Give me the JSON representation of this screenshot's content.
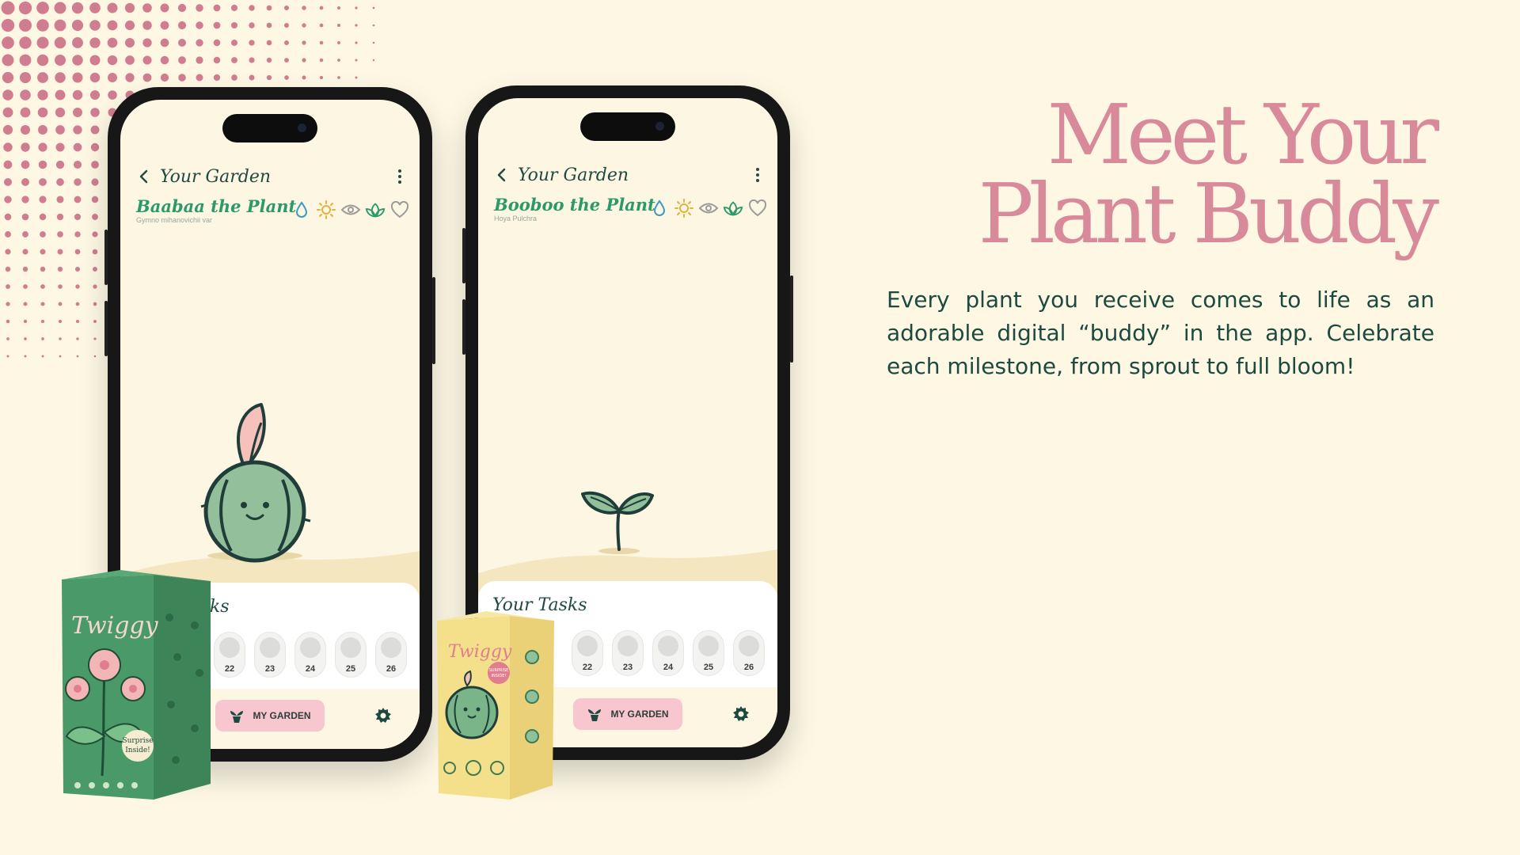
{
  "headline": {
    "line1": "Meet Your",
    "line2": "Plant Buddy"
  },
  "description": "Every plant you receive comes to life as an adorable digital “buddy” in the app. Celebrate each milestone, from sprout to full bloom!",
  "phones": [
    {
      "header_title": "Your Garden",
      "plant_name": "Baabaa the Plant",
      "plant_species": "Gymno mihanovichii var",
      "tasks_title": "Your Tasks",
      "days": [
        "22",
        "23",
        "24",
        "25",
        "26"
      ],
      "nav_button": "MY GARDEN"
    },
    {
      "header_title": "Your Garden",
      "plant_name": "Booboo the Plant",
      "plant_species": "Hoya Pulchra",
      "tasks_title": "Your Tasks",
      "days": [
        "22",
        "23",
        "24",
        "25",
        "26"
      ],
      "nav_button": "MY GARDEN"
    }
  ],
  "icons": {
    "back": "chevron-left-icon",
    "more": "kebab-menu-icon",
    "stats": [
      "water-drop-icon",
      "sun-icon",
      "eye-icon",
      "leaf-icon",
      "heart-icon"
    ],
    "nav_garden": "plant-pot-icon",
    "nav_settings": "gear-icon"
  },
  "boxes": {
    "green_box": {
      "brand": "Twiggy",
      "badge": "Surprise Inside!"
    },
    "yellow_box": {
      "brand": "Twiggy",
      "badge": "SURPRISE INSIDE!"
    }
  },
  "colors": {
    "background": "#fdf7e4",
    "headline": "#d88a9a",
    "body_text": "#1d4a40",
    "plant_name": "#2a9a6a",
    "nav_button": "#f8c6cf",
    "dots": "#d07d90"
  }
}
